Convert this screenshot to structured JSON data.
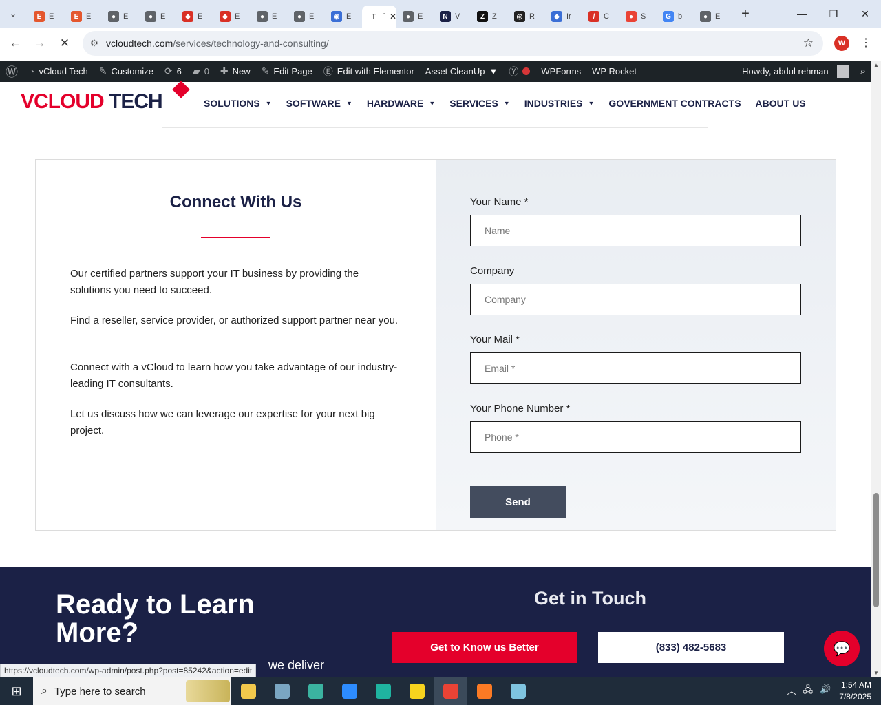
{
  "browser": {
    "tabs": [
      {
        "glyph": "E",
        "color": "#e4572e",
        "label": "E"
      },
      {
        "glyph": "E",
        "color": "#e4572e",
        "label": "E"
      },
      {
        "glyph": "●",
        "color": "#5f6368",
        "label": "E"
      },
      {
        "glyph": "●",
        "color": "#5f6368",
        "label": "E"
      },
      {
        "glyph": "◆",
        "color": "#d93025",
        "label": "E"
      },
      {
        "glyph": "◆",
        "color": "#d93025",
        "label": "E"
      },
      {
        "glyph": "●",
        "color": "#5f6368",
        "label": "E"
      },
      {
        "glyph": "●",
        "color": "#5f6368",
        "label": "E"
      },
      {
        "glyph": "◉",
        "color": "#3b6fd6",
        "label": "E"
      },
      {
        "glyph": "T",
        "color": "#ffffff",
        "label": "Te",
        "active": true
      },
      {
        "glyph": "●",
        "color": "#5f6368",
        "label": "E"
      },
      {
        "glyph": "N",
        "color": "#1b2146",
        "label": "V"
      },
      {
        "glyph": "Z",
        "color": "#111111",
        "label": "Z"
      },
      {
        "glyph": "◎",
        "color": "#222222",
        "label": "R"
      },
      {
        "glyph": "◆",
        "color": "#3b6fd6",
        "label": "Ir"
      },
      {
        "glyph": "/",
        "color": "#d93025",
        "label": "C"
      },
      {
        "glyph": "●",
        "color": "#ea4335",
        "label": "S"
      },
      {
        "glyph": "G",
        "color": "#4285f4",
        "label": "b"
      },
      {
        "glyph": "●",
        "color": "#5f6368",
        "label": "E"
      }
    ],
    "url_host": "vcloudtech.com",
    "url_path": "/services/technology-and-consulting/",
    "profile_initial": "W",
    "status_url": "https://vcloudtech.com/wp-admin/post.php?post=85242&action=edit"
  },
  "adminbar": {
    "site_name": "vCloud Tech",
    "customize": "Customize",
    "updates": "6",
    "comments": "0",
    "new": "New",
    "edit_page": "Edit Page",
    "elementor": "Edit with Elementor",
    "asset_cleanup": "Asset CleanUp",
    "wpforms": "WPForms",
    "wprocket": "WP Rocket",
    "howdy": "Howdy, abdul rehman"
  },
  "site": {
    "logo_left": "VCLOUD",
    "logo_right": "TECH",
    "nav": [
      {
        "label": "SOLUTIONS",
        "dropdown": true
      },
      {
        "label": "SOFTWARE",
        "dropdown": true
      },
      {
        "label": "HARDWARE",
        "dropdown": true
      },
      {
        "label": "SERVICES",
        "dropdown": true
      },
      {
        "label": "INDUSTRIES",
        "dropdown": true
      },
      {
        "label": "GOVERNMENT CONTRACTS",
        "dropdown": false
      },
      {
        "label": "ABOUT US",
        "dropdown": false
      }
    ]
  },
  "contact": {
    "title": "Connect With Us",
    "paragraphs": [
      "Our certified partners support your IT business by providing the solutions you need to succeed.",
      "Find a reseller, service provider, or authorized support partner near you.",
      "Connect with a vCloud to learn how you take advantage of our industry-leading IT consultants.",
      "Let us discuss how we can leverage our expertise for your next big project."
    ],
    "fields": [
      {
        "label": "Your Name *",
        "placeholder": "Name",
        "value": ""
      },
      {
        "label": "Company",
        "placeholder": "Company",
        "value": ""
      },
      {
        "label": "Your Mail *",
        "placeholder": "Email *",
        "value": ""
      },
      {
        "label": "Your Phone Number *",
        "placeholder": "Phone *",
        "value": ""
      }
    ],
    "send_label": "Send"
  },
  "footer": {
    "title": "Ready to Learn More?",
    "subtitle": "we deliver",
    "get_in_touch": "Get in Touch",
    "button_primary": "Get to Know us Better",
    "button_phone": "(833) 482-5683"
  },
  "taskbar": {
    "search_placeholder": "Type here to search",
    "apps": [
      {
        "name": "file-explorer-icon",
        "color": "#f2c94c"
      },
      {
        "name": "paint-icon",
        "color": "#7aa6c2"
      },
      {
        "name": "app-diamond-icon",
        "color": "#3bb3a0"
      },
      {
        "name": "zoom-icon",
        "color": "#2d8cff"
      },
      {
        "name": "edge-icon",
        "color": "#1fb4a0"
      },
      {
        "name": "sticky-notes-icon",
        "color": "#f7d31e"
      },
      {
        "name": "chrome-icon",
        "color": "#ea4335",
        "active": true
      },
      {
        "name": "xampp-icon",
        "color": "#fb7a24"
      },
      {
        "name": "notepad-icon",
        "color": "#7fc4e0"
      }
    ],
    "time": "1:54 AM",
    "date": "7/8/2025"
  }
}
